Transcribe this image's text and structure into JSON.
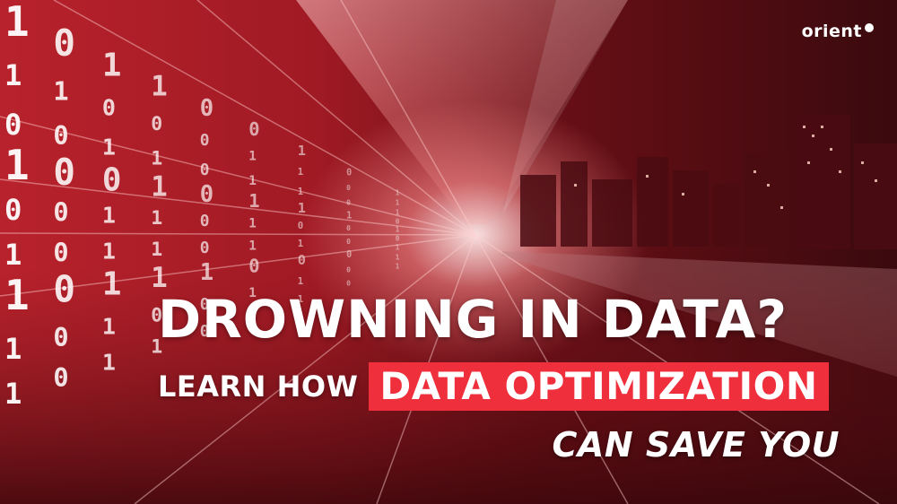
{
  "brand": {
    "logo_text": "orient"
  },
  "headline": {
    "line1": "DROWNING IN DATA?",
    "line2_prefix": "LEARN HOW",
    "line2_highlight": "DATA OPTIMIZATION",
    "line3": "CAN SAVE YOU"
  },
  "colors": {
    "highlight_bg": "#ef2f3c",
    "text": "#ffffff",
    "bg_red": "#b8222c",
    "bg_dark": "#3a0a0e"
  },
  "background": {
    "theme": "binary data stream tunnel with night city skyline",
    "digits": [
      "1",
      "0",
      "1",
      "1",
      "0",
      "0",
      "1",
      "0",
      "1",
      "1",
      "1",
      "0",
      "0",
      "0",
      "1",
      "1",
      "0",
      "1",
      "0",
      "0",
      "1",
      "1",
      "0",
      "1"
    ]
  }
}
